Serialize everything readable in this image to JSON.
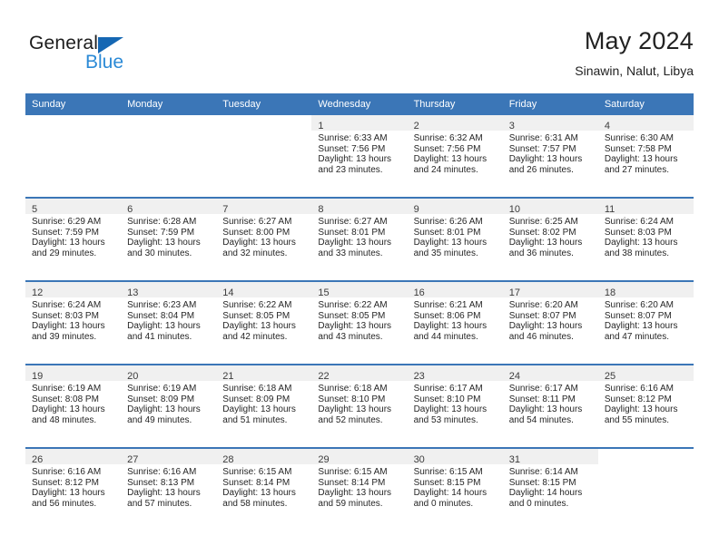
{
  "brand": {
    "name_top": "General",
    "name_bottom": "Blue",
    "triangle_color": "#1567b3",
    "blue_color": "#2b8ad6"
  },
  "header": {
    "title": "May 2024",
    "location": "Sinawin, Nalut, Libya"
  },
  "theme": {
    "header_bar_color": "#3b76b7",
    "row_divider_color": "#3b76b7",
    "daynum_band_color": "#f0f0f0",
    "text_color": "#262626"
  },
  "calendar": {
    "weekday_headers": [
      "Sunday",
      "Monday",
      "Tuesday",
      "Wednesday",
      "Thursday",
      "Friday",
      "Saturday"
    ],
    "weeks": [
      [
        {
          "empty": true
        },
        {
          "empty": true
        },
        {
          "empty": true
        },
        {
          "day": "1",
          "sunrise": "Sunrise: 6:33 AM",
          "sunset": "Sunset: 7:56 PM",
          "daylight1": "Daylight: 13 hours",
          "daylight2": "and 23 minutes."
        },
        {
          "day": "2",
          "sunrise": "Sunrise: 6:32 AM",
          "sunset": "Sunset: 7:56 PM",
          "daylight1": "Daylight: 13 hours",
          "daylight2": "and 24 minutes."
        },
        {
          "day": "3",
          "sunrise": "Sunrise: 6:31 AM",
          "sunset": "Sunset: 7:57 PM",
          "daylight1": "Daylight: 13 hours",
          "daylight2": "and 26 minutes."
        },
        {
          "day": "4",
          "sunrise": "Sunrise: 6:30 AM",
          "sunset": "Sunset: 7:58 PM",
          "daylight1": "Daylight: 13 hours",
          "daylight2": "and 27 minutes."
        }
      ],
      [
        {
          "day": "5",
          "sunrise": "Sunrise: 6:29 AM",
          "sunset": "Sunset: 7:59 PM",
          "daylight1": "Daylight: 13 hours",
          "daylight2": "and 29 minutes."
        },
        {
          "day": "6",
          "sunrise": "Sunrise: 6:28 AM",
          "sunset": "Sunset: 7:59 PM",
          "daylight1": "Daylight: 13 hours",
          "daylight2": "and 30 minutes."
        },
        {
          "day": "7",
          "sunrise": "Sunrise: 6:27 AM",
          "sunset": "Sunset: 8:00 PM",
          "daylight1": "Daylight: 13 hours",
          "daylight2": "and 32 minutes."
        },
        {
          "day": "8",
          "sunrise": "Sunrise: 6:27 AM",
          "sunset": "Sunset: 8:01 PM",
          "daylight1": "Daylight: 13 hours",
          "daylight2": "and 33 minutes."
        },
        {
          "day": "9",
          "sunrise": "Sunrise: 6:26 AM",
          "sunset": "Sunset: 8:01 PM",
          "daylight1": "Daylight: 13 hours",
          "daylight2": "and 35 minutes."
        },
        {
          "day": "10",
          "sunrise": "Sunrise: 6:25 AM",
          "sunset": "Sunset: 8:02 PM",
          "daylight1": "Daylight: 13 hours",
          "daylight2": "and 36 minutes."
        },
        {
          "day": "11",
          "sunrise": "Sunrise: 6:24 AM",
          "sunset": "Sunset: 8:03 PM",
          "daylight1": "Daylight: 13 hours",
          "daylight2": "and 38 minutes."
        }
      ],
      [
        {
          "day": "12",
          "sunrise": "Sunrise: 6:24 AM",
          "sunset": "Sunset: 8:03 PM",
          "daylight1": "Daylight: 13 hours",
          "daylight2": "and 39 minutes."
        },
        {
          "day": "13",
          "sunrise": "Sunrise: 6:23 AM",
          "sunset": "Sunset: 8:04 PM",
          "daylight1": "Daylight: 13 hours",
          "daylight2": "and 41 minutes."
        },
        {
          "day": "14",
          "sunrise": "Sunrise: 6:22 AM",
          "sunset": "Sunset: 8:05 PM",
          "daylight1": "Daylight: 13 hours",
          "daylight2": "and 42 minutes."
        },
        {
          "day": "15",
          "sunrise": "Sunrise: 6:22 AM",
          "sunset": "Sunset: 8:05 PM",
          "daylight1": "Daylight: 13 hours",
          "daylight2": "and 43 minutes."
        },
        {
          "day": "16",
          "sunrise": "Sunrise: 6:21 AM",
          "sunset": "Sunset: 8:06 PM",
          "daylight1": "Daylight: 13 hours",
          "daylight2": "and 44 minutes."
        },
        {
          "day": "17",
          "sunrise": "Sunrise: 6:20 AM",
          "sunset": "Sunset: 8:07 PM",
          "daylight1": "Daylight: 13 hours",
          "daylight2": "and 46 minutes."
        },
        {
          "day": "18",
          "sunrise": "Sunrise: 6:20 AM",
          "sunset": "Sunset: 8:07 PM",
          "daylight1": "Daylight: 13 hours",
          "daylight2": "and 47 minutes."
        }
      ],
      [
        {
          "day": "19",
          "sunrise": "Sunrise: 6:19 AM",
          "sunset": "Sunset: 8:08 PM",
          "daylight1": "Daylight: 13 hours",
          "daylight2": "and 48 minutes."
        },
        {
          "day": "20",
          "sunrise": "Sunrise: 6:19 AM",
          "sunset": "Sunset: 8:09 PM",
          "daylight1": "Daylight: 13 hours",
          "daylight2": "and 49 minutes."
        },
        {
          "day": "21",
          "sunrise": "Sunrise: 6:18 AM",
          "sunset": "Sunset: 8:09 PM",
          "daylight1": "Daylight: 13 hours",
          "daylight2": "and 51 minutes."
        },
        {
          "day": "22",
          "sunrise": "Sunrise: 6:18 AM",
          "sunset": "Sunset: 8:10 PM",
          "daylight1": "Daylight: 13 hours",
          "daylight2": "and 52 minutes."
        },
        {
          "day": "23",
          "sunrise": "Sunrise: 6:17 AM",
          "sunset": "Sunset: 8:10 PM",
          "daylight1": "Daylight: 13 hours",
          "daylight2": "and 53 minutes."
        },
        {
          "day": "24",
          "sunrise": "Sunrise: 6:17 AM",
          "sunset": "Sunset: 8:11 PM",
          "daylight1": "Daylight: 13 hours",
          "daylight2": "and 54 minutes."
        },
        {
          "day": "25",
          "sunrise": "Sunrise: 6:16 AM",
          "sunset": "Sunset: 8:12 PM",
          "daylight1": "Daylight: 13 hours",
          "daylight2": "and 55 minutes."
        }
      ],
      [
        {
          "day": "26",
          "sunrise": "Sunrise: 6:16 AM",
          "sunset": "Sunset: 8:12 PM",
          "daylight1": "Daylight: 13 hours",
          "daylight2": "and 56 minutes."
        },
        {
          "day": "27",
          "sunrise": "Sunrise: 6:16 AM",
          "sunset": "Sunset: 8:13 PM",
          "daylight1": "Daylight: 13 hours",
          "daylight2": "and 57 minutes."
        },
        {
          "day": "28",
          "sunrise": "Sunrise: 6:15 AM",
          "sunset": "Sunset: 8:14 PM",
          "daylight1": "Daylight: 13 hours",
          "daylight2": "and 58 minutes."
        },
        {
          "day": "29",
          "sunrise": "Sunrise: 6:15 AM",
          "sunset": "Sunset: 8:14 PM",
          "daylight1": "Daylight: 13 hours",
          "daylight2": "and 59 minutes."
        },
        {
          "day": "30",
          "sunrise": "Sunrise: 6:15 AM",
          "sunset": "Sunset: 8:15 PM",
          "daylight1": "Daylight: 14 hours",
          "daylight2": "and 0 minutes."
        },
        {
          "day": "31",
          "sunrise": "Sunrise: 6:14 AM",
          "sunset": "Sunset: 8:15 PM",
          "daylight1": "Daylight: 14 hours",
          "daylight2": "and 0 minutes."
        },
        {
          "empty": true
        }
      ]
    ]
  }
}
